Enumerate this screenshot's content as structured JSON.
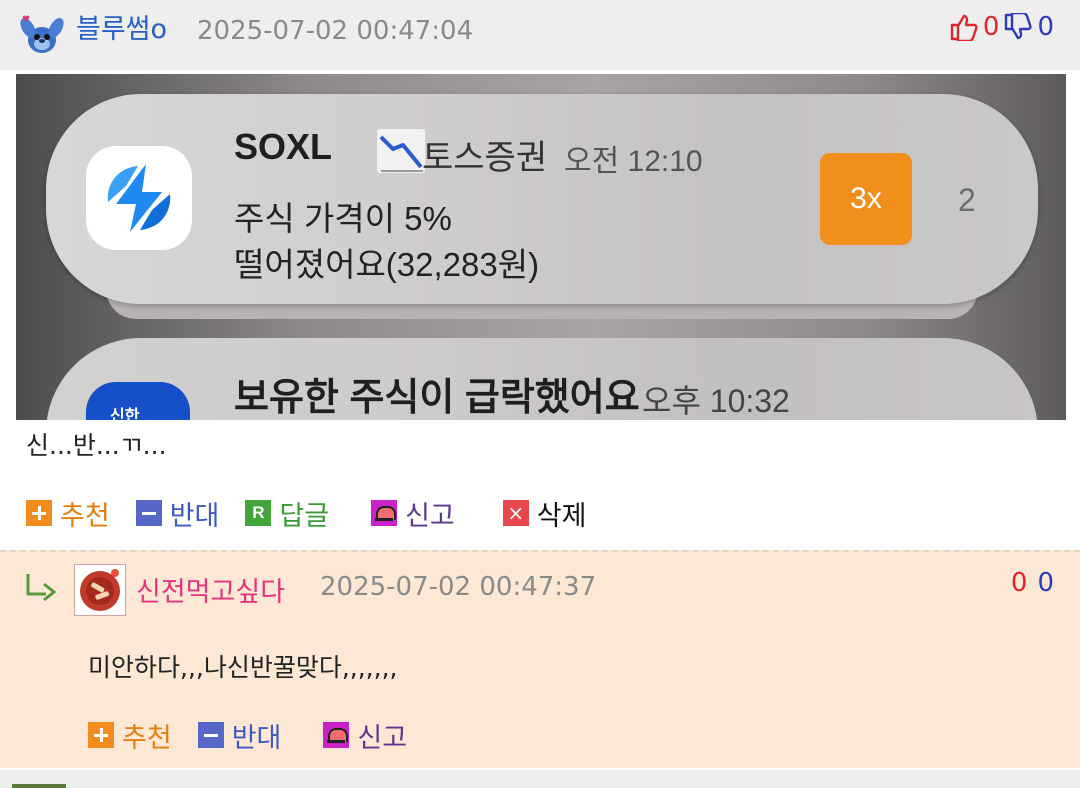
{
  "comment": {
    "author": "블루썸o",
    "datetime": "2025-07-02 00:47:04",
    "likes": "0",
    "dislikes": "0",
    "body": "신...반...ㄲ...",
    "actions": {
      "recommend": "추천",
      "oppose": "반대",
      "reply": "답글",
      "report": "신고",
      "delete": "삭제"
    },
    "image": {
      "notification1": {
        "title": "SOXL",
        "app": "토스증권",
        "time": "오전 12:10",
        "line1": "주식 가격이 5%",
        "line2": "떨어졌어요(32,283원)",
        "badge": "3x",
        "count": "2"
      },
      "notification2": {
        "app_icon_text": "신한",
        "title": "보유한 주식이 급락했어요",
        "time": "오후 10:32"
      }
    }
  },
  "reply": {
    "author": "신전먹고싶다",
    "datetime": "2025-07-02 00:47:37",
    "likes": "0",
    "dislikes": "0",
    "body": "미안하다,,,나신반꿀맞다,,,,,,,",
    "actions": {
      "recommend": "추천",
      "oppose": "반대",
      "report": "신고"
    }
  },
  "colors": {
    "header_bg": "#eeeeee",
    "author_blue": "#2561c4",
    "reply_author_pink": "#e3347f",
    "reply_bg": "#fde8d5",
    "badge_orange": "#f08f1c"
  },
  "icons": [
    "stitch-avatar-icon",
    "thumbs-up-icon",
    "thumbs-down-icon",
    "toss-app-icon",
    "chart-down-emoji-icon",
    "shinhan-app-icon",
    "plus-icon",
    "minus-icon",
    "reply-r-icon",
    "report-bell-icon",
    "delete-x-icon",
    "reply-arrow-icon",
    "tteokbokki-avatar-icon"
  ]
}
